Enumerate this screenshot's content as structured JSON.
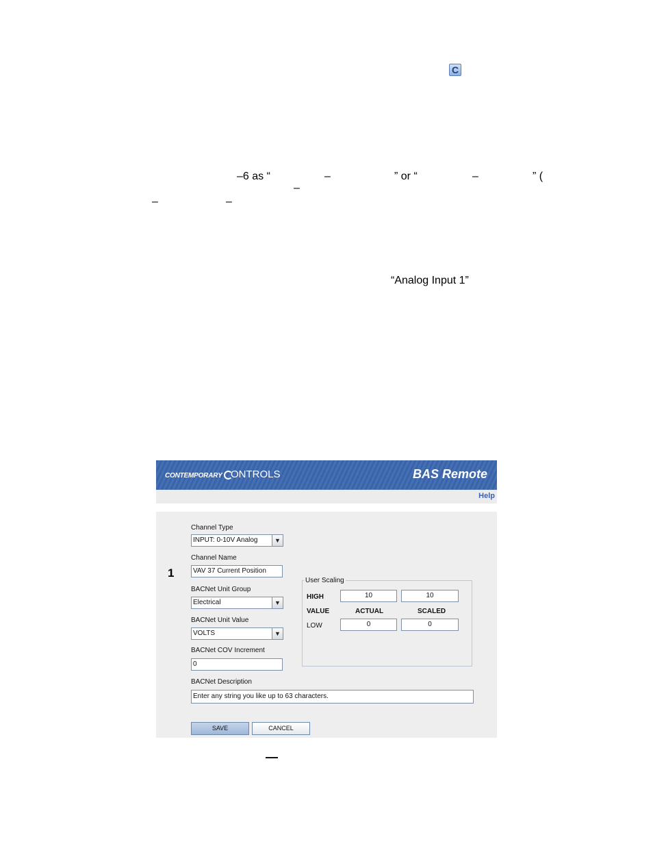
{
  "doc": {
    "badge": "C",
    "frag1": "–6 as “",
    "frag2": "–",
    "frag3": "” or “",
    "frag4": "–",
    "frag5": "” (",
    "frag6": "–",
    "frag7": "–",
    "frag8": "–",
    "quote": "“Analog Input 1”",
    "caption_dash": "—"
  },
  "header": {
    "brand_prefix": "CONTEMPORARY",
    "brand_suffix": "ONTROLS",
    "product": "BAS Remote",
    "help": "Help"
  },
  "channel": {
    "number": "1",
    "type_label": "Channel Type",
    "type_value": "INPUT: 0-10V Analog",
    "name_label": "Channel Name",
    "name_value": "VAV 37 Current Position",
    "unit_group_label": "BACNet Unit Group",
    "unit_group_value": "Electrical",
    "unit_value_label": "BACNet Unit Value",
    "unit_value_value": "VOLTS",
    "cov_label": "BACNet COV Increment",
    "cov_value": "0",
    "desc_label": "BACNet Description",
    "desc_value": "Enter any string you like up to 63 characters."
  },
  "scaling": {
    "legend": "User Scaling",
    "high_label": "HIGH",
    "value_label": "VALUE",
    "low_label": "LOW",
    "actual_header": "ACTUAL",
    "scaled_header": "SCALED",
    "high_actual": "10",
    "high_scaled": "10",
    "low_actual": "0",
    "low_scaled": "0"
  },
  "buttons": {
    "save": "SAVE",
    "cancel": "CANCEL"
  },
  "colors": {
    "banner": "#3b63a8",
    "help_link": "#3a62b8",
    "panel": "#eeeeee"
  }
}
